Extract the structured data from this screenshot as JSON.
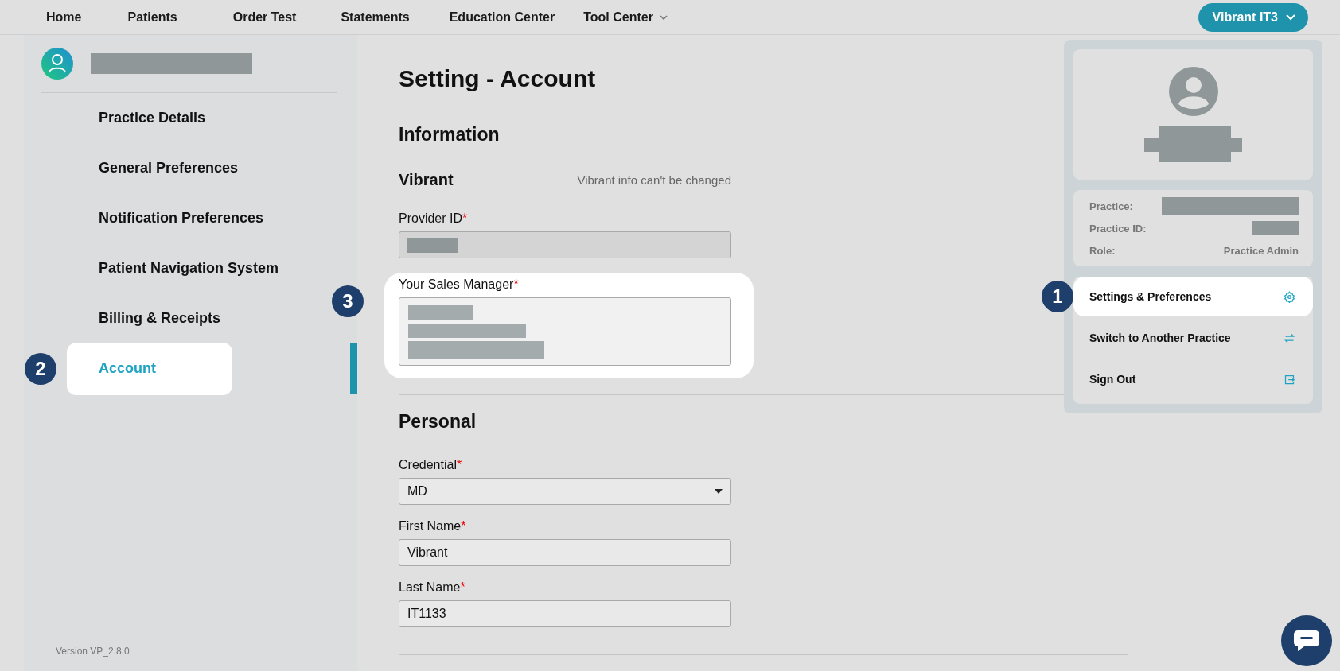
{
  "nav": {
    "items": [
      {
        "label": "Home",
        "kind": "link"
      },
      {
        "label": "Patients",
        "kind": "link"
      },
      {
        "label": "Order Test",
        "kind": "link"
      },
      {
        "label": "Statements",
        "kind": "link"
      },
      {
        "label": "Education Center",
        "kind": "link"
      },
      {
        "label": "Tool Center",
        "kind": "menu"
      }
    ],
    "user_button": "Vibrant IT3"
  },
  "sidebar": {
    "items": [
      {
        "label": "Practice Details",
        "selected": false
      },
      {
        "label": "General Preferences",
        "selected": false
      },
      {
        "label": "Notification Preferences",
        "selected": false
      },
      {
        "label": "Patient Navigation System",
        "selected": false
      },
      {
        "label": "Billing & Receipts",
        "selected": false
      },
      {
        "label": "Account",
        "selected": true,
        "step_marker": "2"
      }
    ],
    "version": "Version VP_2.8.0"
  },
  "main": {
    "title": "Setting - Account",
    "sections": [
      {
        "heading": "Information",
        "subheading": "Vibrant",
        "note": "Vibrant info can't be changed",
        "fields": [
          {
            "label": "Provider ID",
            "required_mark": "*",
            "kind": "redacted_input",
            "highlighted": false
          },
          {
            "label": "Your Sales Manager",
            "required_mark": "*",
            "kind": "redacted_textarea",
            "highlighted": true,
            "step_marker": "3"
          }
        ]
      },
      {
        "heading": "Personal",
        "fields": [
          {
            "label": "Credential",
            "required_mark": "*",
            "kind": "select",
            "value": "MD",
            "highlighted": false
          },
          {
            "label": "First Name",
            "required_mark": "*",
            "kind": "input",
            "value": "Vibrant",
            "highlighted": false
          },
          {
            "label": "Last Name",
            "required_mark": "*",
            "kind": "input",
            "value": "IT1133",
            "highlighted": false
          }
        ]
      }
    ]
  },
  "user_menu": {
    "info": [
      {
        "label": "Practice:",
        "kind": "redacted"
      },
      {
        "label": "Practice ID:",
        "kind": "redacted_short"
      },
      {
        "label": "Role:",
        "kind": "text",
        "value": "Practice Admin"
      }
    ],
    "items": [
      {
        "label": "Settings & Preferences",
        "kind": "settings",
        "highlighted": true,
        "step_marker": "1"
      },
      {
        "label": "Switch to Another Practice",
        "kind": "switch",
        "highlighted": false
      },
      {
        "label": "Sign Out",
        "kind": "signout",
        "highlighted": false
      }
    ]
  }
}
